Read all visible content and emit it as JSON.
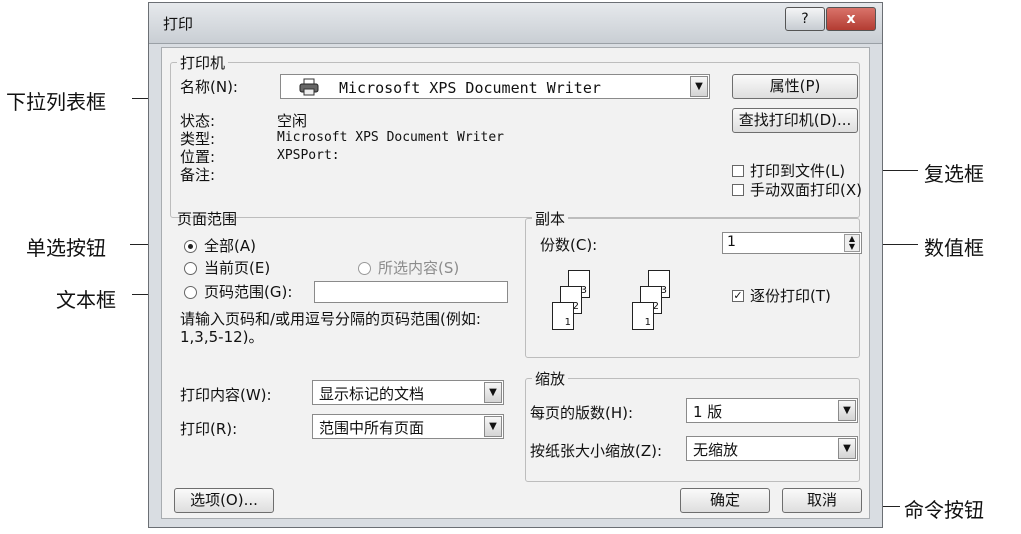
{
  "dialog": {
    "title": "打印",
    "help_label": "?",
    "close_label": "x",
    "printer": {
      "group_label": "打印机",
      "name_label": "名称(N):",
      "name_value": "Microsoft XPS Document Writer",
      "properties_button": "属性(P)",
      "find_printer_button": "查找打印机(D)...",
      "status_label": "状态:",
      "status_value": "空闲",
      "type_label": "类型:",
      "type_value": "Microsoft XPS Document Writer",
      "where_label": "位置:",
      "where_value": "XPSPort:",
      "comment_label": "备注:",
      "print_to_file": "打印到文件(L)",
      "manual_duplex": "手动双面打印(X)"
    },
    "page_range": {
      "group_label": "页面范围",
      "all": "全部(A)",
      "current_page": "当前页(E)",
      "selection": "所选内容(S)",
      "pages": "页码范围(G):",
      "hint": "请输入页码和/或用逗号分隔的页码范围(例如: 1,3,5-12)。"
    },
    "copies": {
      "group_label": "副本",
      "count_label": "份数(C):",
      "count_value": "1",
      "collate": "逐份打印(T)",
      "sheet_numbers": [
        "1",
        "2",
        "3"
      ]
    },
    "print_what": {
      "label": "打印内容(W):",
      "value": "显示标记的文档"
    },
    "print": {
      "label": "打印(R):",
      "value": "范围中所有页面"
    },
    "zoom": {
      "group_label": "缩放",
      "pages_per_sheet_label": "每页的版数(H):",
      "pages_per_sheet_value": "1 版",
      "scale_label": "按纸张大小缩放(Z):",
      "scale_value": "无缩放"
    },
    "options_button": "选项(O)...",
    "ok_button": "确定",
    "cancel_button": "取消"
  },
  "annotations": {
    "dropdown": "下拉列表框",
    "radio": "单选按钮",
    "textbox": "文本框",
    "checkbox": "复选框",
    "spinner": "数值框",
    "command": "命令按钮"
  },
  "icons": {
    "printer": "printer-icon",
    "dropdown_arrow": "chevron-down-icon",
    "checkmark": "check-icon",
    "spinner": "spinner-arrows-icon"
  }
}
